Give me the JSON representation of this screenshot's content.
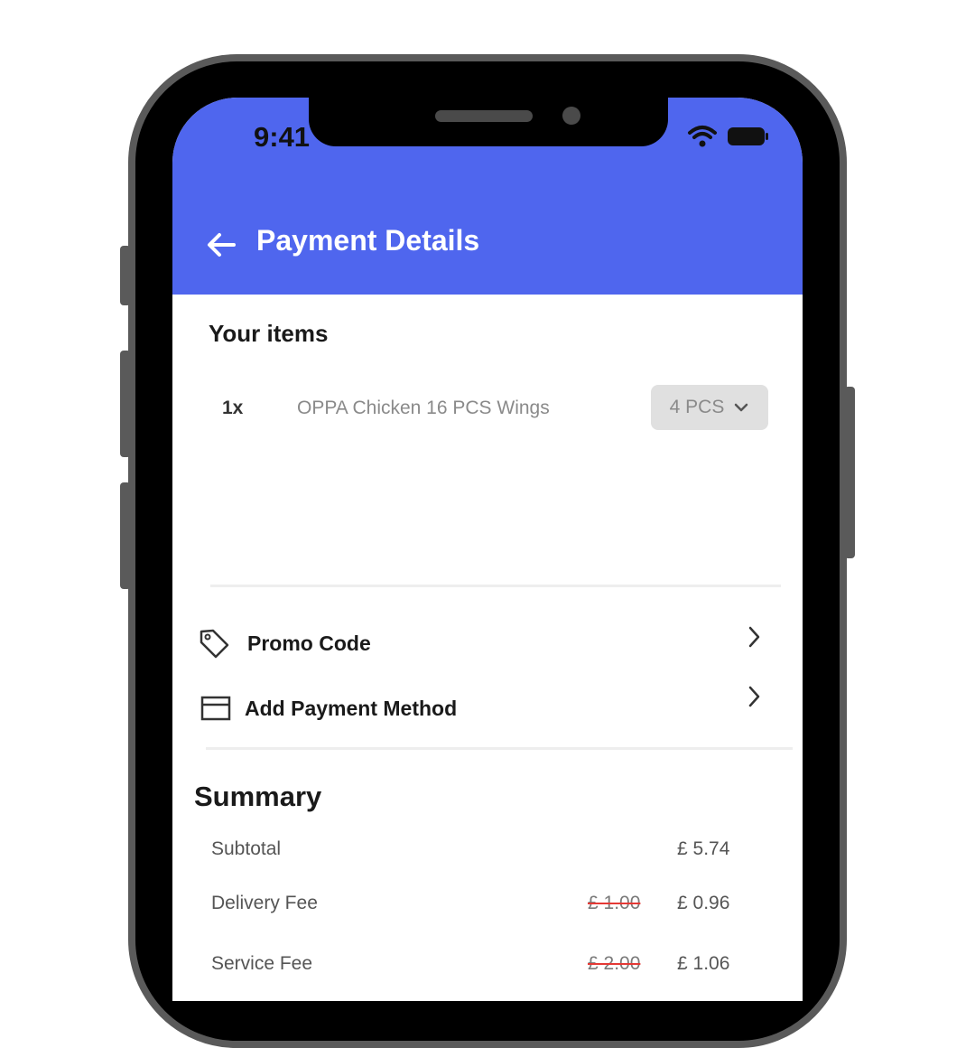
{
  "status_bar": {
    "time": "9:41"
  },
  "header": {
    "title": "Payment Details"
  },
  "items_section": {
    "title": "Your items",
    "items": [
      {
        "qty": "1x",
        "name": "OPPA Chicken 16 PCS Wings",
        "variant": "4 PCS"
      }
    ]
  },
  "options": {
    "promo_label": "Promo Code",
    "payment_label": "Add Payment Method"
  },
  "summary": {
    "title": "Summary",
    "subtotal_label": "Subtotal",
    "subtotal_value": "£ 5.74",
    "delivery_label": "Delivery Fee",
    "delivery_old": "£ 1.00",
    "delivery_value": "£ 0.96",
    "service_label": "Service Fee",
    "service_old": "£ 2.00",
    "service_value": "£ 1.06"
  },
  "colors": {
    "accent": "#4f66ee",
    "strike": "#e53935"
  }
}
